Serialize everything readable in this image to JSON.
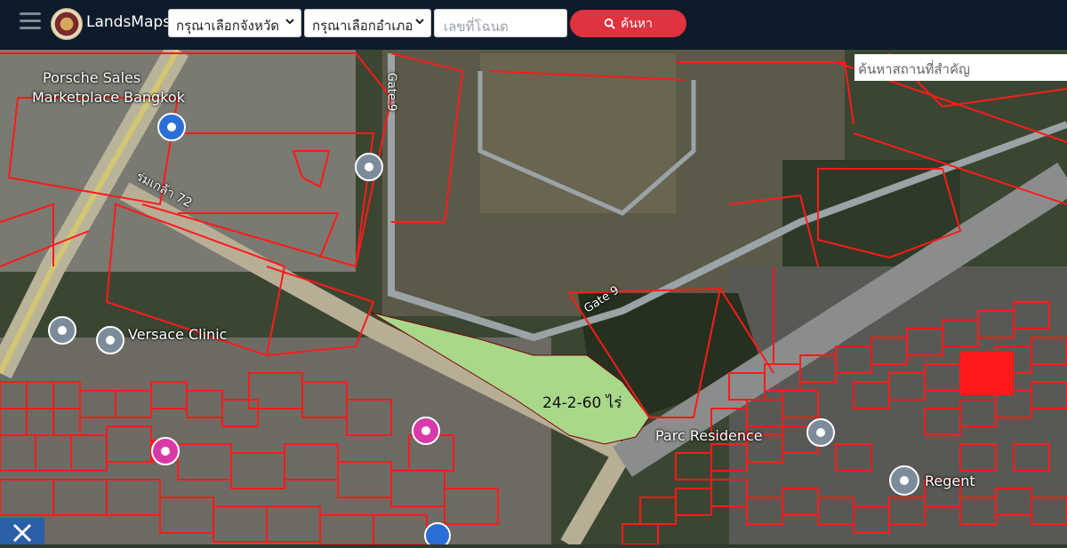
{
  "header": {
    "brand": "LandsMaps",
    "province_select": "กรุณาเลือกจังหวัด",
    "district_select": "กรุณาเลือกอำเภอ",
    "deed_placeholder": "เลขที่โฉนด",
    "search_label": "ค้นหา"
  },
  "map": {
    "place_search_placeholder": "ค้นหาสถานที่สำคัญ",
    "plot_area_label": "24-2-60 ไร่",
    "labels": {
      "porsche_1": "Porsche Sales",
      "porsche_2": "Marketplace Bangkok",
      "gate9_a": "Gate 9",
      "gate9_b": "Gate 9",
      "versace": "Versace Clinic",
      "parc": "Parc Residence",
      "regent": "Regent",
      "soi": "ร่มเกล้า 72"
    },
    "colors": {
      "parcel_line": "#ff1a1a",
      "plot_fill": "#a8d88a",
      "topbar": "#0d1b2a",
      "search_button": "#e0323f"
    },
    "icons": [
      "menu-icon",
      "logo-icon",
      "search-icon",
      "poi-icon",
      "crosshair-icon"
    ]
  }
}
